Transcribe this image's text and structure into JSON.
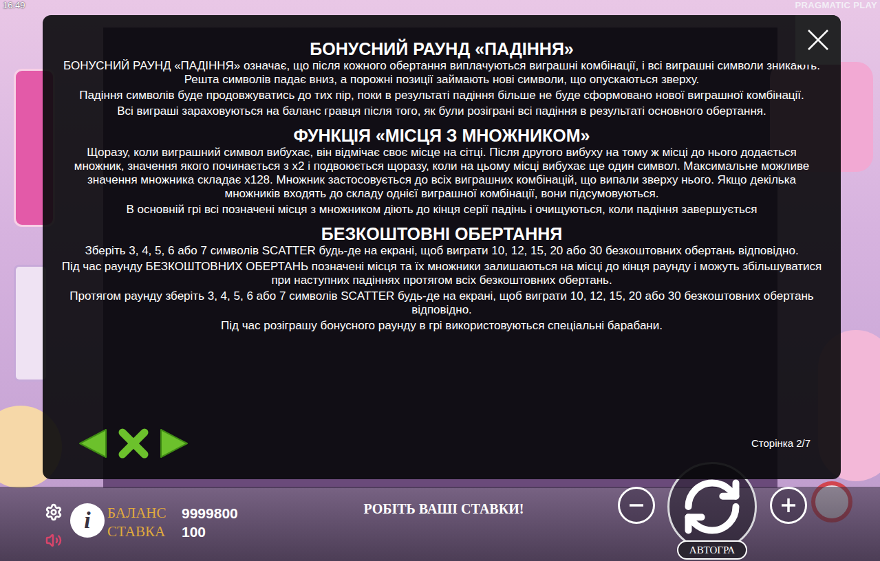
{
  "status_bar": {
    "time": "16:49",
    "brand": "PRAGMATIC PLAY"
  },
  "dialog": {
    "sections": [
      {
        "title": "БОНУСНИЙ РАУНД «ПАДІННЯ»",
        "paragraphs": [
          "БОНУСНИЙ РАУНД «ПАДІННЯ» означає, що після кожного обертання виплачуються виграшні комбінації, і всі виграшні символи зникають. Решта символів падає вниз, а порожні позиції займають нові символи, що опускаються зверху.",
          "Падіння символів буде продовжуватись до тих пір, поки в результаті падіння більше не буде сформовано нової виграшної комбінації.",
          "Всі виграші зараховуються на баланс гравця після того, як були розіграні всі падіння в результаті основного обертання."
        ]
      },
      {
        "title": "ФУНКЦІЯ «МІСЦЯ З МНОЖНИКОМ»",
        "paragraphs": [
          "Щоразу, коли виграшний символ вибухає, він відмічає своє місце на сітці. Після другого вибуху на тому ж місці до нього додається множник, значення якого починається з x2 і подвоюється щоразу, коли на цьому місці вибухає ще один символ. Максимальне можливе значення множника складає x128. Множник застосовується до всіх виграшних комбінацій, що випали зверху нього. Якщо декілька множників входять до складу однієї виграшної комбінації, вони підсумовуються.",
          "В основній грі всі позначені місця з множником діють до кінця серії падінь і очищуються, коли падіння завершується"
        ]
      },
      {
        "title": "БЕЗКОШТОВНІ ОБЕРТАННЯ",
        "paragraphs": [
          "Зберіть 3, 4, 5, 6 або 7 символів SCATTER будь-де на екрані, щоб виграти 10, 12, 15, 20 або 30 безкоштовних обертань відповідно.",
          "Під час раунду БЕЗКОШТОВНИХ ОБЕРТАНЬ позначені місця та їх множники залишаються на місці до кінця раунду і можуть збільшуватися при наступних падіннях протягом всіх безкоштовних обертань.",
          "Протягом раунду зберіть 3, 4, 5, 6 або 7 символів SCATTER будь-де на екрані, щоб виграти 10, 12, 15, 20 або 30 безкоштовних обертань відповідно.",
          "Під час розіграшу бонусного раунду в грі використовуються спеціальні барабани."
        ]
      }
    ],
    "page": "Сторінка 2/7"
  },
  "bottom_bar": {
    "info_icon": "i",
    "balance_label": "БАЛАНС",
    "balance": "9999800",
    "bet_label": "СТАВКА",
    "bet": "100",
    "message": "РОБІТЬ ВАШІ СТАВКИ!",
    "autoplay": "АВТОГРА"
  }
}
